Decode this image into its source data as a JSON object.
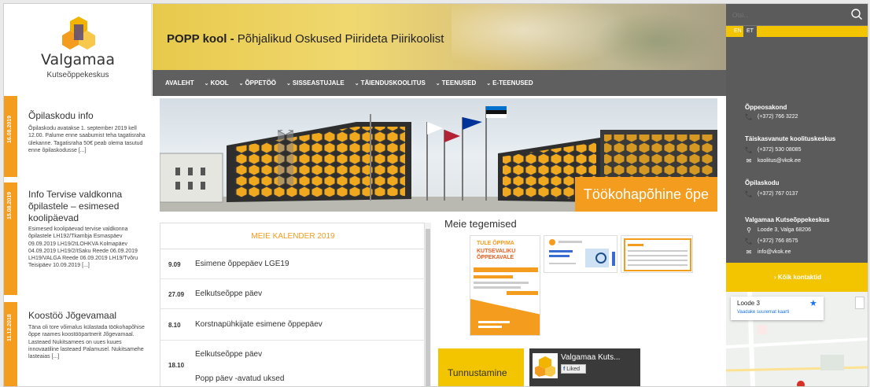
{
  "logo": {
    "name": "Valgamaa",
    "sub": "Kutseõppekeskus"
  },
  "header": {
    "title_bold": "POPP kool -",
    "title_rest": " Põhjalikud Oskused Piirideta Piirikoolist"
  },
  "nav": [
    {
      "label": "AVALEHT",
      "chevron": false
    },
    {
      "label": "KOOL",
      "chevron": true
    },
    {
      "label": "ÕPPETÖÖ",
      "chevron": true
    },
    {
      "label": "SISSEASTUJALE",
      "chevron": true
    },
    {
      "label": "TÄIENDUSKOOLITUS",
      "chevron": true
    },
    {
      "label": "TEENUSED",
      "chevron": true
    },
    {
      "label": "E-TEENUSED",
      "chevron": true
    }
  ],
  "search": {
    "placeholder": "Otsi..."
  },
  "languages": {
    "en": "EN",
    "et": "ET"
  },
  "news": [
    {
      "date": "16.08.2019",
      "title": "Õpilaskodu info",
      "body": "Õpilaskodu avatakse 1. september 2019 kell 12.00. Palume enne saabumist teha tagatisraha ülekanne. Tagatisraha 50€ peab olema tasutud enne õpilaskodusse [...]"
    },
    {
      "date": "15.08.2019",
      "title": "Info Tervise valdkonna õpilastele – esimesed koolipäevad",
      "body": "Esimesed koolipäevad tervise valdkonna õpilastele LH192/Tkambja Esmaspäev 09.09.2019 LH19/2tLOHKVA Kolmapäev 04.09.2019 LH19/2/tSaku Reede 06.09.2019 LH19/VALGA Reede 06.09.2019 LH19/Tvõru Teisipäev 10.09.2019 [...]"
    },
    {
      "date": "11.12.2018",
      "title": "Koostöö Jõgevamaal",
      "body": "Täna oli tore võimalus külastada töökohapõhise õppe raames koostööpartnerit Jõgevamaal. Lasteaed Nukitsamees on uues kuues innovaatiline lasteaed Palamusel. Nukitsamehe lasteaias [...]"
    }
  ],
  "hero": {
    "caption": "Töökohapõhine õpe"
  },
  "calendar": {
    "title": "MEIE KALENDER 2019",
    "events": [
      {
        "date": "9.09",
        "event": "Esimene õppepäev LGE19"
      },
      {
        "date": "27.09",
        "event": "Eelkutseõppe päev"
      },
      {
        "date": "8.10",
        "event": "Korstnapühkijate esimene õppepäev"
      },
      {
        "date": "18.10",
        "event": "Eelkutseõppe päev"
      },
      {
        "date": "",
        "event": "Popp päev -avatud uksed"
      }
    ]
  },
  "tegemised": {
    "title": "Meie tegemised",
    "poster_line1": "TULE ÕPPIMA",
    "poster_line2": "KUTSEVALIKU ÕPPEKAVALE"
  },
  "tunnustamine": "Tunnustamine",
  "facebook": {
    "page_name": "Valgamaa Kuts...",
    "liked": "Liked"
  },
  "contacts": {
    "sections": [
      {
        "heading": "Õppeosakond",
        "lines": [
          {
            "icon": "phone-icon",
            "text": "(+372) 766 3222"
          }
        ]
      },
      {
        "heading": "Täiskasvanute koolituskeskus",
        "lines": [
          {
            "icon": "phone-icon",
            "text": "(+372) 530 08085"
          },
          {
            "icon": "mail-icon",
            "text": "koolitus@vkok.ee"
          }
        ]
      },
      {
        "heading": "Õpilaskodu",
        "lines": [
          {
            "icon": "phone-icon",
            "text": "(+372) 767 0137"
          }
        ]
      },
      {
        "heading": "Valgamaa Kutseõppekeskus",
        "lines": [
          {
            "icon": "location-icon",
            "text": "Loode 3, Valga 68206"
          },
          {
            "icon": "phone-icon",
            "text": "(+372) 766 8575"
          },
          {
            "icon": "mail-icon",
            "text": "info@vkok.ee"
          }
        ]
      }
    ],
    "all_link": "› Kõik kontaktid"
  },
  "map": {
    "place": "Loode 3",
    "link": "Vaadake suuremat kaarti"
  },
  "colors": {
    "accent_orange": "#f39c1e",
    "accent_yellow": "#f3c400",
    "dark_gray": "#5b5b5b"
  }
}
